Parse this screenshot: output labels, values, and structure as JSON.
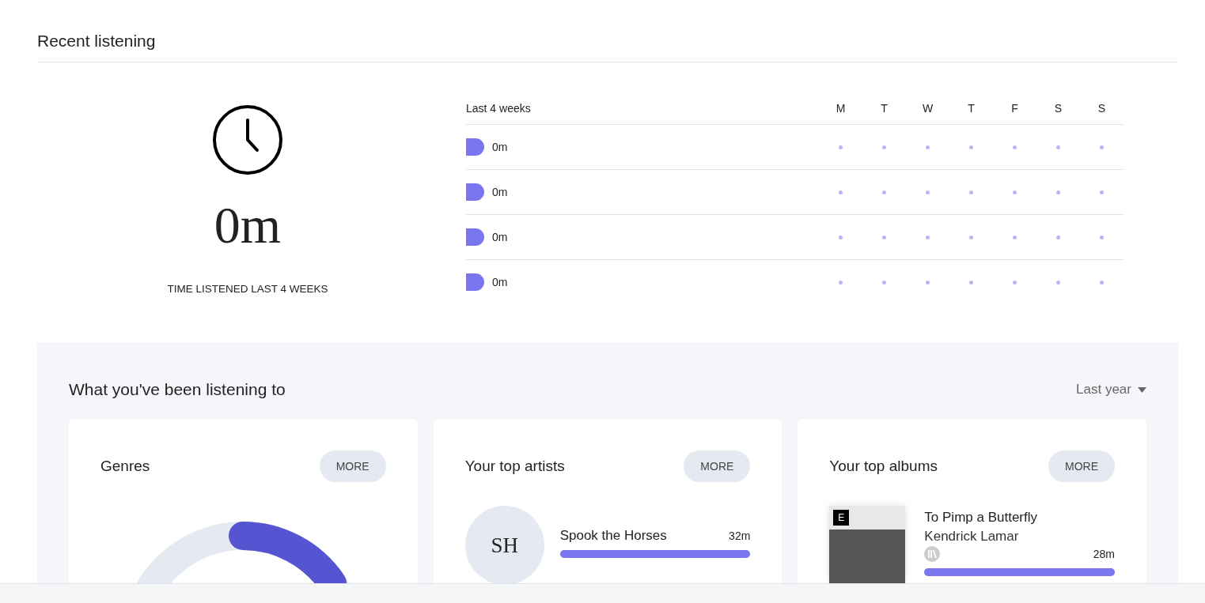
{
  "recent": {
    "title": "Recent listening",
    "total": "0m",
    "caption": "TIME LISTENED LAST 4 WEEKS",
    "period": "Last 4 weeks",
    "days": [
      "M",
      "T",
      "W",
      "T",
      "F",
      "S",
      "S"
    ],
    "weeks": [
      {
        "time": "0m"
      },
      {
        "time": "0m"
      },
      {
        "time": "0m"
      },
      {
        "time": "0m"
      }
    ]
  },
  "listening": {
    "title": "What you've been listening to",
    "range": "Last year",
    "genres": {
      "title": "Genres",
      "more": "MORE"
    },
    "artists": {
      "title": "Your top artists",
      "more": "MORE",
      "items": [
        {
          "initials": "SH",
          "name": "Spook the Horses",
          "time": "32m",
          "level": 1
        }
      ]
    },
    "albums": {
      "title": "Your top albums",
      "more": "MORE",
      "items": [
        {
          "title": "To Pimp a Butterfly",
          "artist": "Kendrick Lamar",
          "badge": "E",
          "time": "28m",
          "level": 1
        }
      ]
    }
  }
}
